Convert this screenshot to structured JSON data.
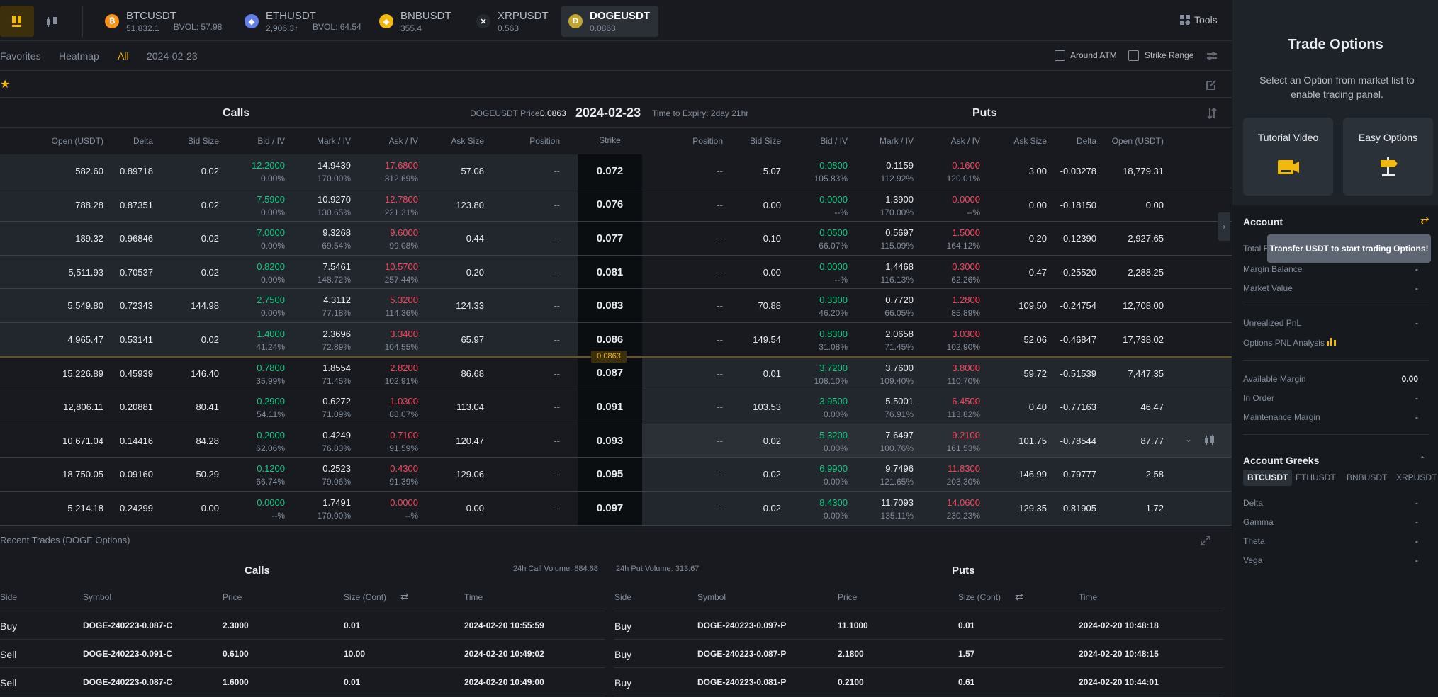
{
  "colors": {
    "accent": "#f0b90b",
    "green": "#0ecb81",
    "red": "#f6465d",
    "text": "#eaecef",
    "muted": "#848e9c"
  },
  "topbar": {
    "coins": [
      {
        "symbol": "BTCUSDT",
        "price": "51,832.1",
        "bvol": "BVOL: 57.98",
        "icon": "bitcoin-icon",
        "color": "#f7931a",
        "glyph": "₿"
      },
      {
        "symbol": "ETHUSDT",
        "price": "2,906.3↑",
        "bvol": "BVOL: 64.54",
        "icon": "ethereum-icon",
        "color": "#627eea",
        "glyph": "◆",
        "up": true
      },
      {
        "symbol": "BNBUSDT",
        "price": "355.4",
        "bvol": "",
        "icon": "bnb-icon",
        "color": "#f0b90b",
        "glyph": "◈"
      },
      {
        "symbol": "XRPUSDT",
        "price": "0.563",
        "bvol": "",
        "icon": "xrp-icon",
        "color": "#23292f",
        "glyph": "✕"
      },
      {
        "symbol": "DOGEUSDT",
        "price": "0.0863",
        "bvol": "",
        "icon": "doge-icon",
        "color": "#c2a633",
        "glyph": "Ð",
        "selected": true
      }
    ],
    "tools_label": "Tools"
  },
  "filters": {
    "favorites": "Favorites",
    "heatmap": "Heatmap",
    "all": "All",
    "date": "2024-02-23",
    "around_atm": "Around ATM",
    "strike_range": "Strike Range"
  },
  "chain": {
    "calls_title": "Calls",
    "puts_title": "Puts",
    "price_label": "DOGEUSDT Price:",
    "price_value": "0.0863",
    "expiry_date": "2024-02-23",
    "time_to_expiry": "Time to Expiry: 2day 21hr",
    "index_price": "0.0863",
    "call_headers": [
      "Open (USDT)",
      "Delta",
      "Bid Size",
      "Bid / IV",
      "Mark / IV",
      "Ask / IV",
      "Ask Size",
      "Position"
    ],
    "strike_header": "Strike",
    "put_headers": [
      "Position",
      "Bid Size",
      "Bid / IV",
      "Mark / IV",
      "Ask / IV",
      "Ask Size",
      "Delta",
      "Open (USDT)"
    ],
    "rows": [
      {
        "strike": "0.072",
        "call": {
          "open": "582.60",
          "delta": "0.89718",
          "bid_size": "0.02",
          "bid": "12.2000",
          "bid_iv": "0.00%",
          "mark": "14.9439",
          "mark_iv": "170.00%",
          "ask": "17.6800",
          "ask_iv": "312.69%",
          "ask_size": "57.08",
          "position": "--"
        },
        "put": {
          "position": "--",
          "bid_size": "5.07",
          "bid": "0.0800",
          "bid_iv": "105.83%",
          "mark": "0.1159",
          "mark_iv": "112.92%",
          "ask": "0.1600",
          "ask_iv": "120.01%",
          "ask_size": "3.00",
          "delta": "-0.03278",
          "open": "18,779.31"
        }
      },
      {
        "strike": "0.076",
        "call": {
          "open": "788.28",
          "delta": "0.87351",
          "bid_size": "0.02",
          "bid": "7.5900",
          "bid_iv": "0.00%",
          "mark": "10.9270",
          "mark_iv": "130.65%",
          "ask": "12.7800",
          "ask_iv": "221.31%",
          "ask_size": "123.80",
          "position": "--"
        },
        "put": {
          "position": "--",
          "bid_size": "0.00",
          "bid": "0.0000",
          "bid_iv": "--%",
          "mark": "1.3900",
          "mark_iv": "170.00%",
          "ask": "0.0000",
          "ask_iv": "--%",
          "ask_size": "0.00",
          "delta": "-0.18150",
          "open": "0.00"
        }
      },
      {
        "strike": "0.077",
        "call": {
          "open": "189.32",
          "delta": "0.96846",
          "bid_size": "0.02",
          "bid": "7.0000",
          "bid_iv": "0.00%",
          "mark": "9.3268",
          "mark_iv": "69.54%",
          "ask": "9.6000",
          "ask_iv": "99.08%",
          "ask_size": "0.44",
          "position": "--"
        },
        "put": {
          "position": "--",
          "bid_size": "0.10",
          "bid": "0.0500",
          "bid_iv": "66.07%",
          "mark": "0.5697",
          "mark_iv": "115.09%",
          "ask": "1.5000",
          "ask_iv": "164.12%",
          "ask_size": "0.20",
          "delta": "-0.12390",
          "open": "2,927.65"
        }
      },
      {
        "strike": "0.081",
        "call": {
          "open": "5,511.93",
          "delta": "0.70537",
          "bid_size": "0.02",
          "bid": "0.8200",
          "bid_iv": "0.00%",
          "mark": "7.5461",
          "mark_iv": "148.72%",
          "ask": "10.5700",
          "ask_iv": "257.44%",
          "ask_size": "0.20",
          "position": "--"
        },
        "put": {
          "position": "--",
          "bid_size": "0.00",
          "bid": "0.0000",
          "bid_iv": "--%",
          "mark": "1.4468",
          "mark_iv": "116.13%",
          "ask": "0.3000",
          "ask_iv": "62.26%",
          "ask_size": "0.47",
          "delta": "-0.25520",
          "open": "2,288.25"
        }
      },
      {
        "strike": "0.083",
        "call": {
          "open": "5,549.80",
          "delta": "0.72343",
          "bid_size": "144.98",
          "bid": "2.7500",
          "bid_iv": "0.00%",
          "mark": "4.3112",
          "mark_iv": "77.18%",
          "ask": "5.3200",
          "ask_iv": "114.36%",
          "ask_size": "124.33",
          "position": "--"
        },
        "put": {
          "position": "--",
          "bid_size": "70.88",
          "bid": "0.3300",
          "bid_iv": "46.20%",
          "mark": "0.7720",
          "mark_iv": "66.05%",
          "ask": "1.2800",
          "ask_iv": "85.89%",
          "ask_size": "109.50",
          "delta": "-0.24754",
          "open": "12,708.00"
        }
      },
      {
        "strike": "0.086",
        "call": {
          "open": "4,965.47",
          "delta": "0.53141",
          "bid_size": "0.02",
          "bid": "1.4000",
          "bid_iv": "41.24%",
          "mark": "2.3696",
          "mark_iv": "72.89%",
          "ask": "3.3400",
          "ask_iv": "104.55%",
          "ask_size": "65.97",
          "position": "--"
        },
        "put": {
          "position": "--",
          "bid_size": "149.54",
          "bid": "0.8300",
          "bid_iv": "31.08%",
          "mark": "2.0658",
          "mark_iv": "71.45%",
          "ask": "3.0300",
          "ask_iv": "102.90%",
          "ask_size": "52.06",
          "delta": "-0.46847",
          "open": "17,738.02"
        }
      },
      {
        "strike": "0.087",
        "call": {
          "open": "15,226.89",
          "delta": "0.45939",
          "bid_size": "146.40",
          "bid": "0.7800",
          "bid_iv": "35.99%",
          "mark": "1.8554",
          "mark_iv": "71.45%",
          "ask": "2.8200",
          "ask_iv": "102.91%",
          "ask_size": "86.68",
          "position": "--"
        },
        "put": {
          "position": "--",
          "bid_size": "0.01",
          "bid": "3.7200",
          "bid_iv": "108.10%",
          "mark": "3.7600",
          "mark_iv": "109.40%",
          "ask": "3.8000",
          "ask_iv": "110.70%",
          "ask_size": "59.72",
          "delta": "-0.51539",
          "open": "7,447.35"
        }
      },
      {
        "strike": "0.091",
        "call": {
          "open": "12,806.11",
          "delta": "0.20881",
          "bid_size": "80.41",
          "bid": "0.2900",
          "bid_iv": "54.11%",
          "mark": "0.6272",
          "mark_iv": "71.09%",
          "ask": "1.0300",
          "ask_iv": "88.07%",
          "ask_size": "113.04",
          "position": "--"
        },
        "put": {
          "position": "--",
          "bid_size": "103.53",
          "bid": "3.9500",
          "bid_iv": "0.00%",
          "mark": "5.5001",
          "mark_iv": "76.91%",
          "ask": "6.4500",
          "ask_iv": "113.82%",
          "ask_size": "0.40",
          "delta": "-0.77163",
          "open": "46.47"
        }
      },
      {
        "strike": "0.093",
        "hover": true,
        "call": {
          "open": "10,671.04",
          "delta": "0.14416",
          "bid_size": "84.28",
          "bid": "0.2000",
          "bid_iv": "62.06%",
          "mark": "0.4249",
          "mark_iv": "76.83%",
          "ask": "0.7100",
          "ask_iv": "91.59%",
          "ask_size": "120.47",
          "position": "--"
        },
        "put": {
          "position": "--",
          "bid_size": "0.02",
          "bid": "5.3200",
          "bid_iv": "0.00%",
          "mark": "7.6497",
          "mark_iv": "100.76%",
          "ask": "9.2100",
          "ask_iv": "161.53%",
          "ask_size": "101.75",
          "delta": "-0.78544",
          "open": "87.77"
        }
      },
      {
        "strike": "0.095",
        "call": {
          "open": "18,750.05",
          "delta": "0.09160",
          "bid_size": "50.29",
          "bid": "0.1200",
          "bid_iv": "66.74%",
          "mark": "0.2523",
          "mark_iv": "79.06%",
          "ask": "0.4300",
          "ask_iv": "91.39%",
          "ask_size": "129.06",
          "position": "--"
        },
        "put": {
          "position": "--",
          "bid_size": "0.02",
          "bid": "6.9900",
          "bid_iv": "0.00%",
          "mark": "9.7496",
          "mark_iv": "121.65%",
          "ask": "11.8300",
          "ask_iv": "203.30%",
          "ask_size": "146.99",
          "delta": "-0.79777",
          "open": "2.58"
        }
      },
      {
        "strike": "0.097",
        "call": {
          "open": "5,214.18",
          "delta": "0.24299",
          "bid_size": "0.00",
          "bid": "0.0000",
          "bid_iv": "--%",
          "mark": "1.7491",
          "mark_iv": "170.00%",
          "ask": "0.0000",
          "ask_iv": "--%",
          "ask_size": "0.00",
          "position": "--"
        },
        "put": {
          "position": "--",
          "bid_size": "0.02",
          "bid": "8.4300",
          "bid_iv": "0.00%",
          "mark": "11.7093",
          "mark_iv": "135.11%",
          "ask": "14.0600",
          "ask_iv": "230.23%",
          "ask_size": "129.35",
          "delta": "-0.81905",
          "open": "1.72"
        }
      }
    ]
  },
  "recent": {
    "title": "Recent Trades (DOGE Options)",
    "calls_title": "Calls",
    "puts_title": "Puts",
    "call_volume": "24h Call Volume: 884.68",
    "put_volume": "24h Put Volume: 313.67",
    "headers": [
      "Side",
      "Symbol",
      "Price",
      "Size (Cont)",
      "Time"
    ],
    "calls": [
      {
        "side": "Buy",
        "symbol": "DOGE-240223-0.087-C",
        "price": "2.3000",
        "size": "0.01",
        "time": "2024-02-20 10:55:59"
      },
      {
        "side": "Sell",
        "symbol": "DOGE-240223-0.091-C",
        "price": "0.6100",
        "size": "10.00",
        "time": "2024-02-20 10:49:02"
      },
      {
        "side": "Sell",
        "symbol": "DOGE-240223-0.087-C",
        "price": "1.6000",
        "size": "0.01",
        "time": "2024-02-20 10:49:00"
      }
    ],
    "puts": [
      {
        "side": "Buy",
        "symbol": "DOGE-240223-0.097-P",
        "price": "11.1000",
        "size": "0.01",
        "time": "2024-02-20 10:48:18"
      },
      {
        "side": "Buy",
        "symbol": "DOGE-240223-0.087-P",
        "price": "2.1800",
        "size": "1.57",
        "time": "2024-02-20 10:48:15"
      },
      {
        "side": "Buy",
        "symbol": "DOGE-240223-0.081-P",
        "price": "0.2100",
        "size": "0.61",
        "time": "2024-02-20 10:44:01"
      }
    ]
  },
  "panel": {
    "title": "Trade Options",
    "subtitle": "Select an Option from market list to enable trading panel.",
    "tutorial": "Tutorial Video",
    "easy": "Easy Options",
    "account_title": "Account",
    "tooltip": "Transfer USDT to start trading Options!",
    "total_label": "Total E",
    "margin_balance": "Margin Balance",
    "margin_balance_v": "-",
    "market_value": "Market Value",
    "market_value_v": "-",
    "unrealized": "Unrealized PnL",
    "unrealized_v": "-",
    "pnl_analysis": "Options PNL Analysis",
    "available": "Available Margin",
    "available_v": "0.00",
    "in_order": "In Order",
    "in_order_v": "-",
    "maintenance": "Maintenance Margin",
    "maintenance_v": "-",
    "greeks_title": "Account Greeks",
    "greek_tabs": [
      "BTCUSDT",
      "ETHUSDT",
      "BNBUSDT",
      "XRPUSDT"
    ],
    "greeks": [
      {
        "name": "Delta",
        "value": "-"
      },
      {
        "name": "Gamma",
        "value": "-"
      },
      {
        "name": "Theta",
        "value": "-"
      },
      {
        "name": "Vega",
        "value": "-"
      }
    ]
  }
}
